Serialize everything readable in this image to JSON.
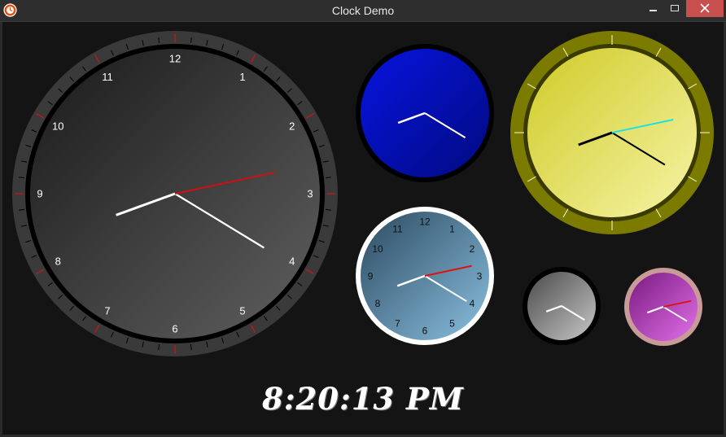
{
  "window": {
    "title": "Clock Demo",
    "minimize_icon": "minimize-icon",
    "maximize_icon": "maximize-icon",
    "close_icon": "close-icon",
    "app_icon": "clock-app-icon"
  },
  "time": {
    "hours": 8,
    "minutes": 20,
    "seconds": 13,
    "display": "8:20:13 PM"
  },
  "clocks": {
    "large": {
      "numerals": [
        "12",
        "1",
        "2",
        "3",
        "4",
        "5",
        "6",
        "7",
        "8",
        "9",
        "10",
        "11"
      ],
      "colors": {
        "face": "#2e2e2e",
        "bezel": "#3a3a3a",
        "hands": "#ffffff",
        "second_hand": "#d01010",
        "tick_accent": "#c01818"
      }
    },
    "blue": {
      "colors": {
        "face": "#0a10c8",
        "hands": "#ffffff"
      }
    },
    "yellow": {
      "colors": {
        "face": "#e2e050",
        "bezel": "#7b7b00",
        "hands": "#000000",
        "second_hand": "#20e0e0"
      }
    },
    "steel_blue": {
      "numerals": [
        "12",
        "1",
        "2",
        "3",
        "4",
        "5",
        "6",
        "7",
        "8",
        "9",
        "10",
        "11"
      ],
      "colors": {
        "face": "#4e7f9e",
        "hands": "#ffffff",
        "second_hand": "#e01010"
      }
    },
    "gray": {
      "colors": {
        "face": "#8a8a8a",
        "hands": "#ffffff"
      }
    },
    "purple": {
      "colors": {
        "face": "#b040b8",
        "bezel": "#c89a98",
        "hands": "#ffffff",
        "second_hand": "#e01010"
      }
    }
  }
}
